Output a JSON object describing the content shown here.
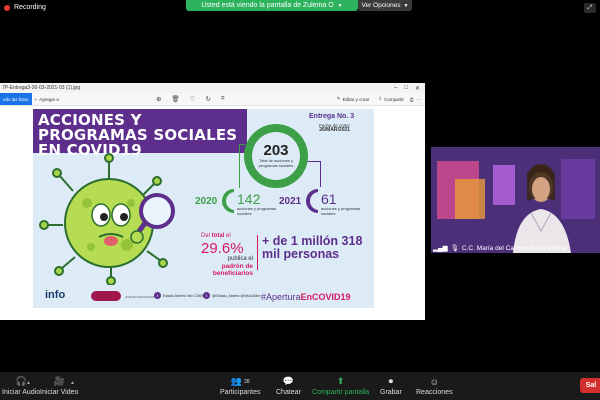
{
  "top": {
    "recording_label": "Recording",
    "share_banner": "Usted está viendo la pantalla de Zulema O",
    "view_options": "Ver Opciones",
    "icons": {
      "recording": "record-dot-icon",
      "dropdown": "chevron-down-icon",
      "fullscreen": "fullscreen-icon"
    }
  },
  "window": {
    "title": "7P-Entrega3-26-03-2021-03 (1).jpg",
    "controls": [
      "–",
      "□",
      "✕"
    ],
    "toolbar": {
      "left_button": "odo las fotos",
      "add_label": "Agregar a",
      "edit_label": "Editar y crear",
      "share_label": "Compartir",
      "tool_icons": [
        "zoom-in-icon",
        "delete-icon",
        "favorite-icon",
        "rotate-icon",
        "crop-icon"
      ],
      "more": "···"
    }
  },
  "infographic": {
    "title": "ACCIONES Y PROGRAMAS SOCIALES EN COVID19",
    "entrega": "Entrega No. 3",
    "fecha_label": "Fecha de corte:",
    "fecha": "26/MAR/2021",
    "total": "203",
    "total_label": "Total de acciones y programas sociales",
    "year_2020": "2020",
    "count_2020": "142",
    "label_2020": "acciones y programas sociales",
    "year_2021": "2021",
    "count_2021": "61",
    "label_2021": "acciones y programas sociales",
    "del_total_prefix": "Del",
    "del_total_bold": "total",
    "del_total_suffix": "el",
    "percent": "29.6%",
    "publica": "publica el",
    "padron": "padrón de beneficiarios",
    "plus_text": "+ de 1 millón 318 mil personas",
    "logo_info": "info",
    "logo_ciudad": "CIUDAD INNOVADORA",
    "social_1": "Estado Abierto Info CDMX",
    "social_2": "@Estado_Abierto @InfoCdMex",
    "hashtag_a": "#Apertura",
    "hashtag_b": "EnCOVID19",
    "colors": {
      "purple": "#5d2e8c",
      "green": "#3d9f48",
      "magenta": "#d81b60",
      "bg": "#dcebf5"
    }
  },
  "participant": {
    "name": "C.C. María del Carmen Nava Polina",
    "icons": [
      "signal-bars-icon",
      "mic-icon"
    ]
  },
  "controls": {
    "audio": "Iniciar Audio",
    "video": "Iniciar Video",
    "participants": "Participantes",
    "participants_count": "28",
    "chat": "Chatear",
    "share": "Compartir pantalla",
    "record": "Grabar",
    "reactions": "Reacciones",
    "end": "Sal"
  }
}
